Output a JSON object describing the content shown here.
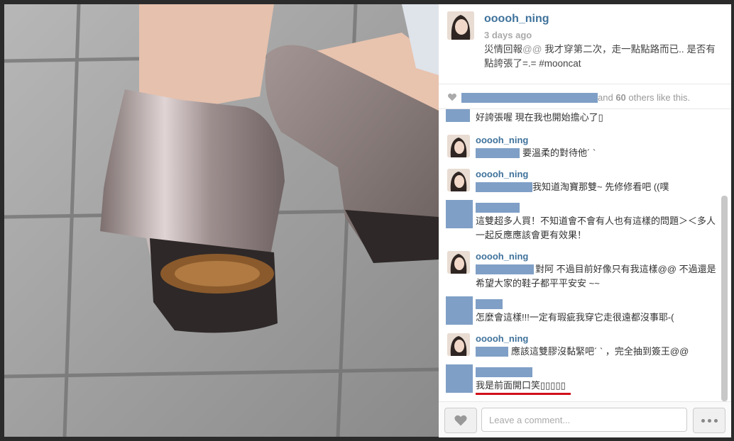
{
  "post": {
    "username": "ooooh_ning",
    "time": "3 days ago",
    "caption_before": "災情回報",
    "caption_at": "@@",
    "caption_after": " 我才穿第二次，走一點點路而已.. 是否有點誇張了=.= #mooncat"
  },
  "likes": {
    "others_prefix": "and ",
    "others_count": "60",
    "others_suffix": " others like this."
  },
  "comments": [
    {
      "text": "好誇張喔 現在我也開始擔心了▯"
    },
    {
      "name": "ooooh_ning",
      "text": "要溫柔的對待他´ `"
    },
    {
      "name": "ooooh_ning",
      "text": "我知道淘寶那雙~ 先修修看吧 ((噗"
    },
    {
      "text": "這雙超多人買！不知道會不會有人也有這樣的問題＞＜多人一起反應應該會更有效果！"
    },
    {
      "name": "ooooh_ning",
      "text": "對阿 不過目前好像只有我這樣@@ 不過還是希望大家的鞋子都平平安安 ~~"
    },
    {
      "text": "怎麼會這樣!!!一定有瑕疵我穿它走很遠都沒事耶-("
    },
    {
      "name": "ooooh_ning",
      "text": "應該這雙膠沒黏緊吧´ ` ，完全抽到簽王@@"
    },
    {
      "text": "我是前面開口笑▯▯▯▯▯"
    }
  ],
  "footer": {
    "comment_placeholder": "Leave a comment..."
  },
  "colors": {
    "username": "#3f729b",
    "redaction": "#7f9fc6",
    "highlight_underline": "#d0101a"
  },
  "icons": [
    "heart-icon",
    "more-options-icon"
  ]
}
